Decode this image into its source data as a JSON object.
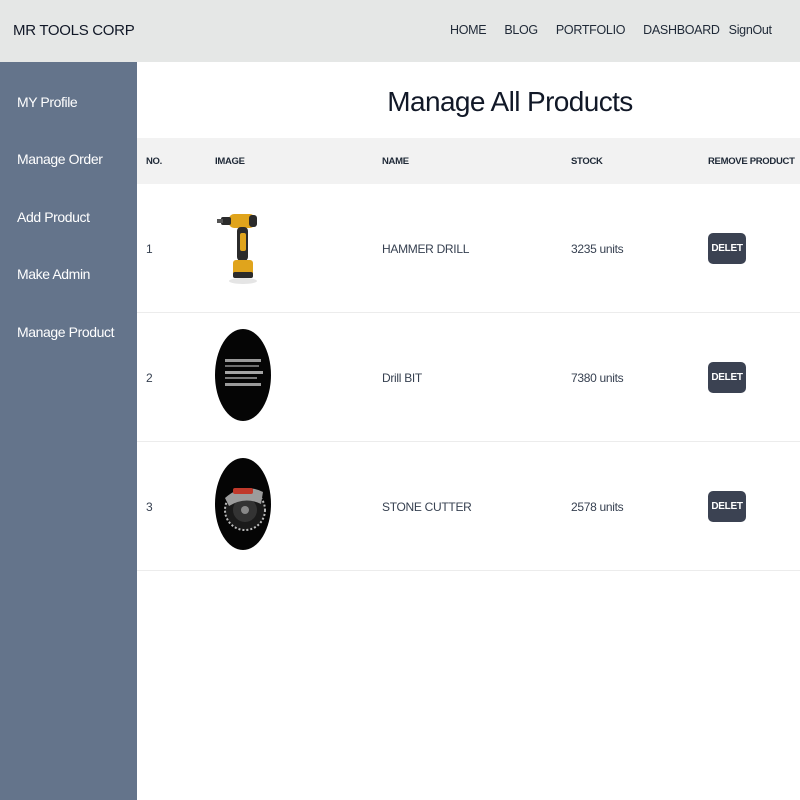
{
  "navbar": {
    "brand": "MR TOOLS CORP",
    "links": {
      "home": "HOME",
      "blog": "BLOG",
      "portfolio": "PORTFOLIO",
      "dashboard": "DASHBOARD",
      "signout": "SignOut"
    }
  },
  "sidebar": {
    "items": [
      {
        "label": "MY Profile"
      },
      {
        "label": "Manage Order"
      },
      {
        "label": "Add Product"
      },
      {
        "label": "Make Admin"
      },
      {
        "label": "Manage Product"
      }
    ]
  },
  "main": {
    "title": "Manage All Products",
    "table": {
      "headers": {
        "no": "NO.",
        "image": "IMAGE",
        "name": "NAME",
        "stock": "STOCK",
        "remove": "REMOVE PRODUCT"
      },
      "rows": [
        {
          "no": "1",
          "image_icon": "hammer-drill-image",
          "name": "HAMMER DRILL",
          "stock": "3235 units",
          "action": "DELET"
        },
        {
          "no": "2",
          "image_icon": "drill-bit-image",
          "name": "Drill BIT",
          "stock": "7380 units",
          "action": "DELET"
        },
        {
          "no": "3",
          "image_icon": "stone-cutter-image",
          "name": "STONE CUTTER",
          "stock": "2578 units",
          "action": "DELET"
        }
      ]
    }
  },
  "colors": {
    "navbar_bg": "#e5e7e6",
    "sidebar_bg": "#64748b",
    "table_header_bg": "#f2f2f2",
    "delete_button_bg": "#3b4252"
  }
}
